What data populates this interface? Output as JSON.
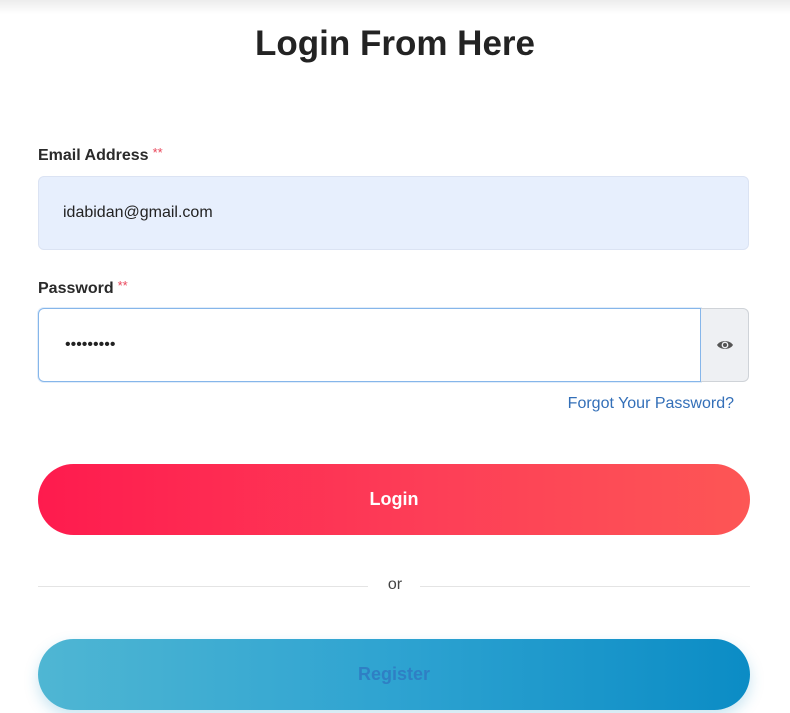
{
  "title": "Login From Here",
  "email": {
    "label": "Email Address",
    "required_mark": "**",
    "value": "idabidan@gmail.com"
  },
  "password": {
    "label": "Password",
    "required_mark": "**",
    "value": "•••••••••",
    "toggle_icon": "eye-icon"
  },
  "forgot_password": "Forgot Your Password?",
  "login_label": "Login",
  "divider_text": "or",
  "register_label": "Register",
  "colors": {
    "login_gradient_start": "#fe1b4e",
    "login_gradient_end": "#fd5655",
    "register_gradient_start": "#4fb6d3",
    "register_gradient_end": "#0b8cc5",
    "link": "#336fb8",
    "required": "#e9475b",
    "email_field_bg": "#e7effd"
  }
}
